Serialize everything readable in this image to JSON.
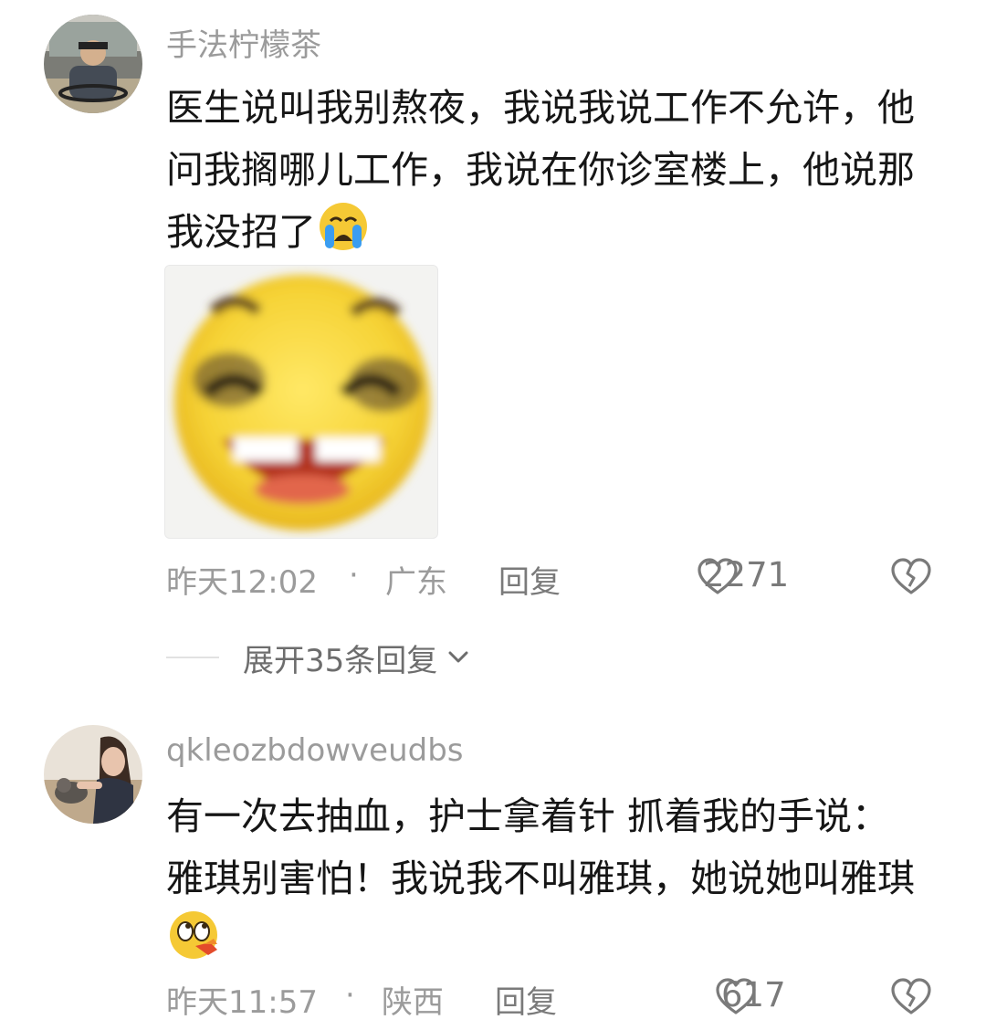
{
  "comments": [
    {
      "username": "手法柠檬茶",
      "text": "医生说叫我别熬夜，我说我说工作不允许，他问我搁哪儿工作，我说在你诊室楼上，他说那我没招了",
      "emoji": "crying-face-icon",
      "time": "昨天12:02",
      "dot": "·",
      "location": "广东",
      "reply_label": "回复",
      "likes": "2271",
      "expand_label": "展开35条回复"
    },
    {
      "username": "qkleozbdowveudbs",
      "text": "有一次去抽血，护士拿着针 抓着我的手说：雅琪别害怕！我说我不叫雅琪，她说她叫雅琪",
      "emoji": "face-with-rolling-eyes-laughing-icon",
      "time": "昨天11:57",
      "dot": "·",
      "location": "陕西",
      "reply_label": "回复",
      "likes": "617"
    }
  ],
  "colors": {
    "meta_gray": "#9b9b9b",
    "text": "#161616",
    "emoji_yellow": "#f5c935"
  }
}
